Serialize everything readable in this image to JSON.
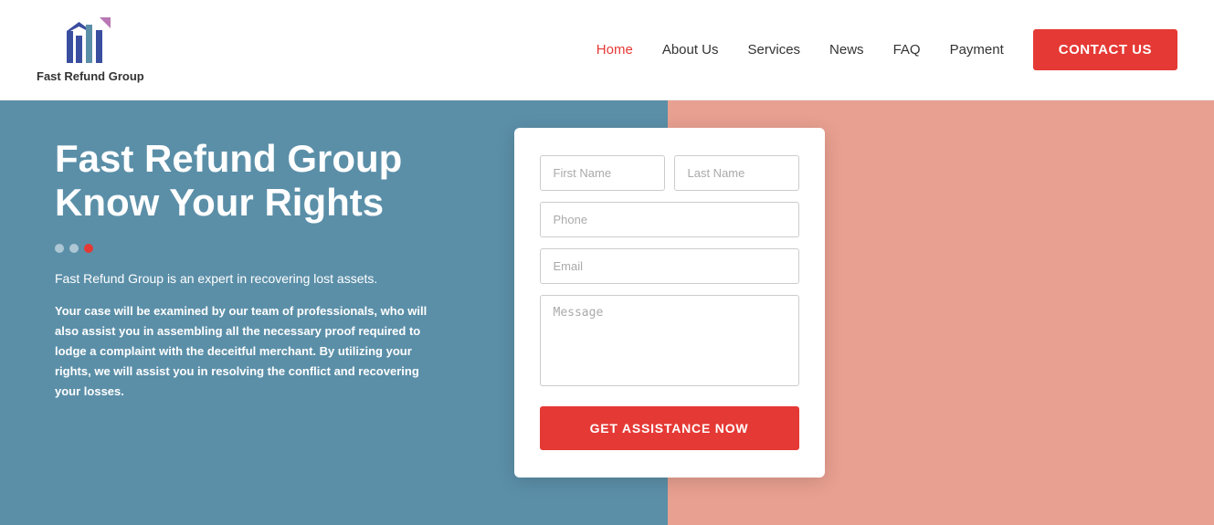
{
  "header": {
    "logo_text": "Fast Refund Group",
    "nav": {
      "home": "Home",
      "about": "About Us",
      "services": "Services",
      "news": "News",
      "faq": "FAQ",
      "payment": "Payment",
      "contact_btn": "CONTACT US"
    }
  },
  "hero": {
    "title": "Fast Refund Group Know Your Rights",
    "desc1": "Fast Refund Group is an expert in recovering lost assets.",
    "desc2": "Your case will be examined by our team of professionals, who will also assist you in assembling all the necessary proof required to lodge a complaint with the deceitful merchant. By utilizing your rights, we will assist you in resolving the conflict and recovering your losses."
  },
  "form": {
    "first_name_placeholder": "First Name",
    "last_name_placeholder": "Last Name",
    "phone_placeholder": "Phone",
    "email_placeholder": "Email",
    "message_placeholder": "Message",
    "submit_label": "GET ASSISTANCE NOW"
  },
  "dots": [
    {
      "active": false
    },
    {
      "active": false
    },
    {
      "active": true
    }
  ]
}
